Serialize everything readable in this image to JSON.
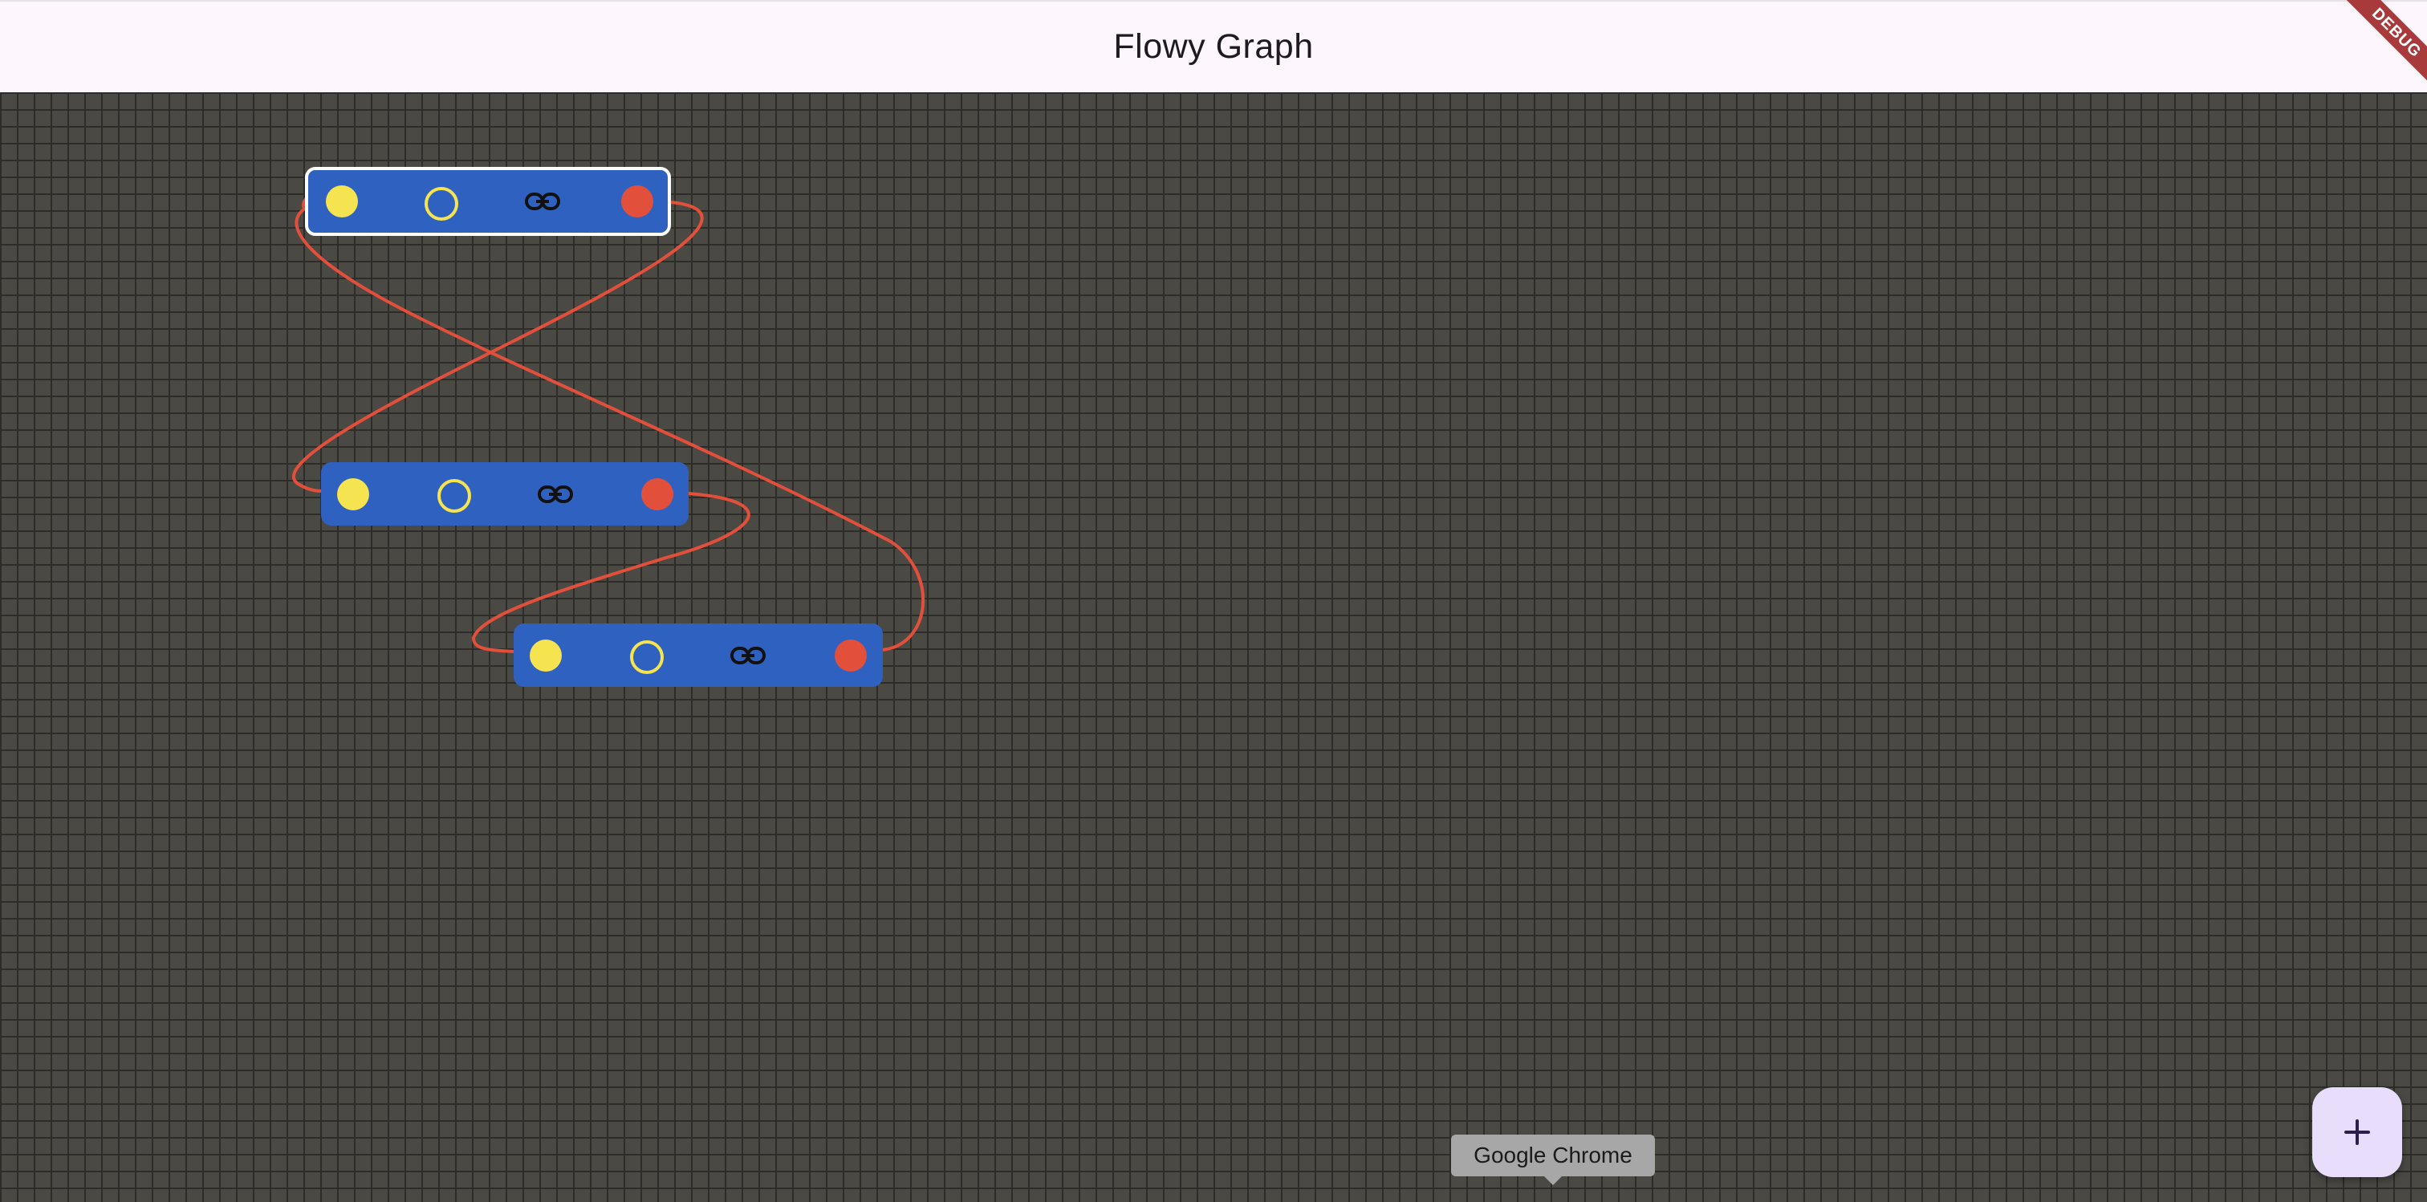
{
  "app_bar": {
    "title": "Flowy Graph"
  },
  "debug_banner": {
    "label": "DEBUG"
  },
  "graph": {
    "nodes": [
      {
        "id": "node-1",
        "selected": true
      },
      {
        "id": "node-2",
        "selected": false
      },
      {
        "id": "node-3",
        "selected": false
      }
    ],
    "edge_color": "#e2503c",
    "node_color": "#2f62c0",
    "port_colors": {
      "input": "#f5e34f",
      "output": "#e2503c"
    }
  },
  "tooltip": {
    "text": "Google Chrome"
  },
  "fab": {
    "icon": "plus-icon"
  }
}
